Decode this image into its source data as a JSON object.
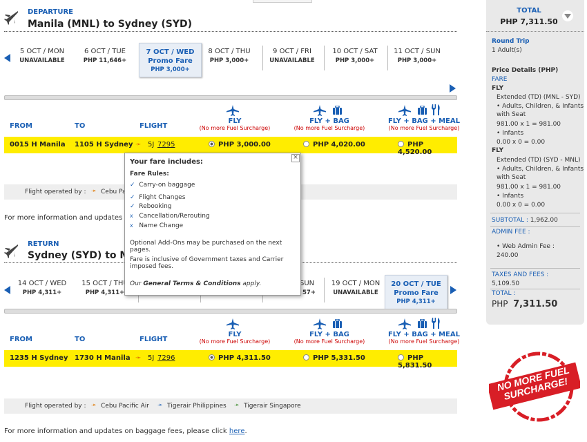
{
  "departure": {
    "label": "DEPARTURE",
    "title": "Manila (MNL) to Sydney (SYD)",
    "dates": [
      {
        "date": "5 OCT / MON",
        "price": "UNAVAILABLE"
      },
      {
        "date": "6 OCT / TUE",
        "price": "PHP 11,646+"
      },
      {
        "date": "7 OCT / WED",
        "promo": "Promo Fare",
        "price": "PHP 3,000+"
      },
      {
        "date": "8 OCT / THU",
        "price": "PHP 3,000+"
      },
      {
        "date": "9 OCT / FRI",
        "price": "UNAVAILABLE"
      },
      {
        "date": "10 OCT / SAT",
        "price": "PHP 3,000+"
      },
      {
        "date": "11 OCT / SUN",
        "price": "PHP 3,000+"
      }
    ],
    "flight": {
      "from": "0015 H  Manila",
      "to": "1105 H  Sydney",
      "code": "5J",
      "number": "7295",
      "fares": [
        "PHP 3,000.00",
        "PHP 4,020.00",
        "PHP 4,520.00"
      ]
    }
  },
  "columns": {
    "from": "FROM",
    "to": "TO",
    "flight": "FLIGHT",
    "fly": "FLY",
    "fly_bag": "FLY + BAG",
    "fly_bag_meal": "FLY + BAG + MEAL",
    "surcharge": "(No more Fuel Surcharge)"
  },
  "operated": {
    "label": "Flight operated by :",
    "carriers": [
      "Cebu Pacific Air",
      "Tigerair Philippines",
      "Tigerair Singapore"
    ],
    "short": "Cebu Pa"
  },
  "info": {
    "text": "For more information and updates on baggage fees, please click",
    "link": "here",
    "dot": ".",
    "short": "For more information and updates on"
  },
  "return": {
    "label": "RETURN",
    "title": "Sydney (SYD) to Manila (MNL)",
    "title_short": "Sydney (SYD) to Mar",
    "dates": [
      {
        "date": "14 OCT / WED",
        "price": "PHP 4,311+"
      },
      {
        "date": "15 OCT / THU",
        "price": "PHP 4,311+"
      },
      {
        "date": "SUN",
        "price": "57+"
      },
      {
        "date": "19 OCT / MON",
        "price": "UNAVAILABLE"
      },
      {
        "date": "20 OCT / TUE",
        "promo": "Promo Fare",
        "price": "PHP 4,311+"
      }
    ],
    "flight": {
      "from": "1235 H  Sydney",
      "to": "1730 H  Manila",
      "code": "5J",
      "number": "7296",
      "fares": [
        "PHP 4,311.50",
        "PHP 5,331.50",
        "PHP 5,831.50"
      ]
    }
  },
  "popup": {
    "title": "Your fare includes:",
    "rules_label": "Fare Rules:",
    "included": [
      "Carry-on baggage",
      "Flight Changes",
      "Rebooking"
    ],
    "excluded": [
      "Cancellation/Rerouting",
      "Name Change"
    ],
    "addons": "Optional Add-Ons may be purchased on the next pages.",
    "taxes_line1": "Fare is inclusive of Government taxes and Carrier",
    "taxes_line2": "imposed fees.",
    "terms_pre": "Our",
    "terms_link": "General Terms & Conditions",
    "terms_post": "apply.",
    "close": "×"
  },
  "summary": {
    "total_label": "TOTAL",
    "total": "PHP 7,311.50",
    "trip_type": "Round Trip",
    "pax": "1 Adult(s)",
    "details_label": "Price Details (PHP)",
    "fare_label": "FARE",
    "fly": "FLY",
    "out_title": "Extended (TD) (MNL - SYD)",
    "out_adults1": "• Adults, Children, & Infants",
    "out_adults2": "with Seat",
    "out_calc": "981.00 x 1 = 981.00",
    "infants": "• Infants",
    "infants_calc": "0.00 x 0 = 0.00",
    "ret_title": "Extended (TD) (SYD - MNL)",
    "ret_calc": "981.00 x 1 = 981.00",
    "subtotal_label": "SUBTOTAL :",
    "subtotal": "1,962.00",
    "admin_label": "ADMIN FEE :",
    "admin_item": "• Web Admin Fee :",
    "admin_value": "240.00",
    "taxes_label": "TAXES AND FEES :",
    "taxes": "5,109.50",
    "total2_label": "TOTAL :",
    "total2_cur": "PHP",
    "total2": "7,311.50"
  },
  "stamp": {
    "line1": "NO MORE FUEL",
    "line2": "SURCHARGE!"
  },
  "colors": {
    "accent": "#1a5fb4",
    "highlight": "#ffed00",
    "surcharge": "#cc0000",
    "stamp": "#d81e26"
  }
}
